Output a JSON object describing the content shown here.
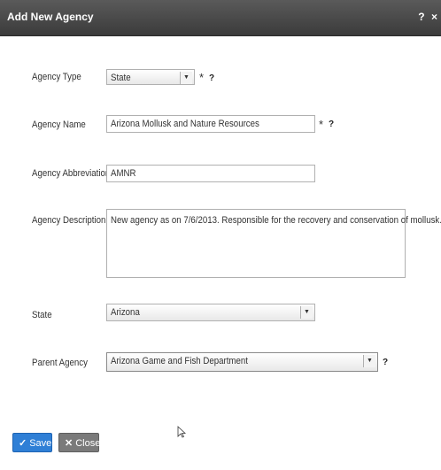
{
  "dialog": {
    "title": "Add New Agency",
    "title_icons": {
      "help": "?",
      "close": "×"
    }
  },
  "form": {
    "agency_type": {
      "label": "Agency Type",
      "value": "State",
      "required_mark": "*",
      "help": "?"
    },
    "agency_name": {
      "label": "Agency Name",
      "value": "Arizona Mollusk and Nature Resources",
      "required_mark": "*",
      "help": "?"
    },
    "agency_abbreviation": {
      "label": "Agency Abbreviation",
      "value": "AMNR"
    },
    "agency_description": {
      "label": "Agency Description",
      "value": "New agency as on 7/6/2013.  Responsible for the recovery and conservation of mollusk."
    },
    "state": {
      "label": "State",
      "value": "Arizona"
    },
    "parent_agency": {
      "label": "Parent Agency",
      "value": "Arizona Game and Fish Department",
      "help": "?"
    }
  },
  "buttons": {
    "save": {
      "icon": "✓",
      "label": "Save"
    },
    "close": {
      "icon": "✕",
      "label": "Close"
    }
  },
  "colors": {
    "titlebar": "#4a4a4a",
    "save_button": "#2f7fd6",
    "close_button": "#7a7a7a"
  }
}
